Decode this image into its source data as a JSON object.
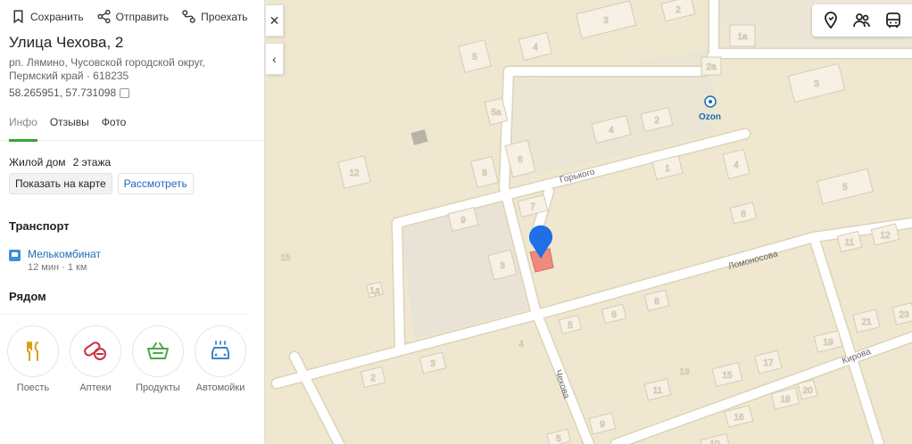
{
  "actions": {
    "save_label": "Сохранить",
    "share_label": "Отправить",
    "route_label": "Проехать"
  },
  "place": {
    "title": "Улица Чехова, 2",
    "address_line1": "рп. Лямино, Чусовской городской округ,",
    "address_line2": "Пермский край · 618235",
    "coordinates": "58.265951, 57.731098"
  },
  "tabs": [
    {
      "label": "Инфо",
      "active": true
    },
    {
      "label": "Отзывы",
      "active": false
    },
    {
      "label": "Фото",
      "active": false
    }
  ],
  "info": {
    "type": "Жилой дом",
    "floors": "2 этажа",
    "show_on_map": "Показать на карте",
    "inspect": "Рассмотреть"
  },
  "transport": {
    "title": "Транспорт",
    "stop_name": "Мелькомбинат",
    "stop_meta": "12 мин · 1 км"
  },
  "nearby": {
    "title": "Рядом",
    "items": [
      {
        "label": "Поесть",
        "icon": "cutlery-icon",
        "color": "#d9a117"
      },
      {
        "label": "Аптеки",
        "icon": "pills-icon",
        "color": "#c8303e"
      },
      {
        "label": "Продукты",
        "icon": "basket-icon",
        "color": "#4aa84a"
      },
      {
        "label": "Автомойки",
        "icon": "car-wash-icon",
        "color": "#3b86c8"
      }
    ]
  },
  "controls": {
    "close": "✕",
    "collapse": "‹"
  },
  "map": {
    "colors": {
      "background": "#efe7cf",
      "road": "#ffffff",
      "road_edge": "#e0d6bd",
      "building": "#f6f1e4",
      "building_edge": "#d9cfb8",
      "highlight_building": "#ef7f73",
      "pin": "#1f6fe6",
      "parking": "#e6e0d2"
    },
    "streets": [
      "Горького",
      "Ломоносова",
      "Кирова",
      "Чехова"
    ],
    "poi": "Ozon",
    "building_numbers": [
      "3",
      "2",
      "4",
      "5",
      "1а",
      "2а",
      "3",
      "5а",
      "4",
      "2",
      "12",
      "8",
      "6",
      "1",
      "4",
      "5",
      "7",
      "9",
      "6",
      "3",
      "15",
      "1д",
      "11",
      "12",
      "8",
      "6",
      "5",
      "4",
      "21",
      "23",
      "19",
      "3",
      "2",
      "13",
      "15",
      "17",
      "11",
      "18",
      "20",
      "9",
      "16",
      "10",
      "5"
    ]
  }
}
